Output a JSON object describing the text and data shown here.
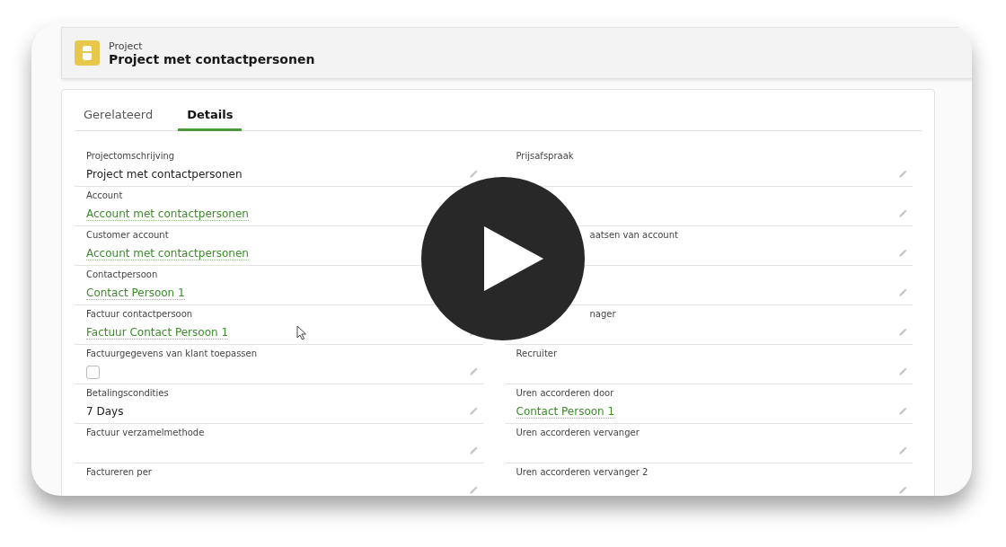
{
  "header": {
    "object_type": "Project",
    "title": "Project met contactpersonen"
  },
  "tabs": [
    {
      "label": "Gerelateerd",
      "selected": false
    },
    {
      "label": "Details",
      "selected": true
    }
  ],
  "left_fields": [
    {
      "label": "Projectomschrijving",
      "value": "Project met contactpersonen",
      "kind": "text"
    },
    {
      "label": "Account",
      "value": "Account met contactpersonen",
      "kind": "link",
      "edit_icon": false
    },
    {
      "label": "Customer account",
      "value": "Account met contactpersonen",
      "kind": "link",
      "edit_icon": false
    },
    {
      "label": "Contactpersoon",
      "value": "Contact Persoon 1",
      "kind": "link",
      "edit_icon": false
    },
    {
      "label": "Factuur contactpersoon",
      "value": "Factuur Contact Persoon 1",
      "kind": "link"
    },
    {
      "label": "Factuurgegevens van klant toepassen",
      "kind": "checkbox",
      "checked": false
    },
    {
      "label": "Betalingscondities",
      "value": "7 Days",
      "kind": "text"
    },
    {
      "label": "Factuur verzamelmethode",
      "kind": "text"
    },
    {
      "label": "Factureren per",
      "kind": "text"
    }
  ],
  "right_fields": [
    {
      "label": "Prijsafspraak",
      "kind": "text"
    },
    {
      "kind": "text"
    },
    {
      "label": "aatsen van account",
      "kind": "text",
      "partly_hidden": true
    },
    {
      "kind": "text"
    },
    {
      "label": "nager",
      "kind": "text",
      "partly_hidden": true
    },
    {
      "label": "Recruiter",
      "kind": "text"
    },
    {
      "label": "Uren accorderen door",
      "value": "Contact Persoon 1",
      "kind": "link"
    },
    {
      "label": "Uren accorderen vervanger",
      "kind": "text"
    },
    {
      "label": "Uren accorderen vervanger 2",
      "kind": "text"
    }
  ]
}
